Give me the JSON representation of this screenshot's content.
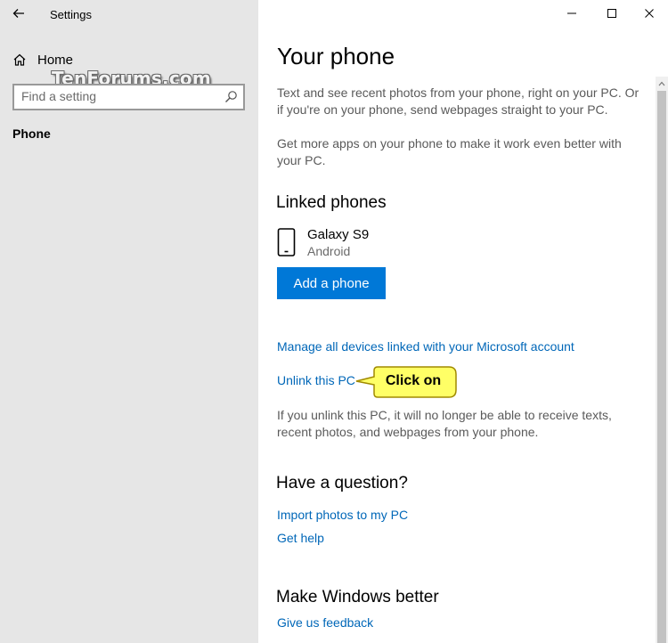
{
  "window": {
    "title": "Settings",
    "controls": {
      "minimize": "minimize",
      "maximize": "maximize",
      "close": "close"
    }
  },
  "sidebar": {
    "home_label": "Home",
    "watermark": "TenForums.com",
    "search_placeholder": "Find a setting",
    "nav_items": [
      {
        "label": "Phone",
        "selected": true
      }
    ]
  },
  "main": {
    "title": "Your phone",
    "description_1": "Text and see recent photos from your phone, right on your PC. Or if you're on your phone, send webpages straight to your PC.",
    "description_2": "Get more apps on your phone to make it work even better with your PC.",
    "linked_phones": {
      "heading": "Linked phones",
      "device": {
        "name": "Galaxy S9",
        "os": "Android"
      },
      "add_button": "Add a phone"
    },
    "links": {
      "manage": "Manage all devices linked with your Microsoft account",
      "unlink": "Unlink this PC"
    },
    "unlink_note": "If you unlink this PC, it will no longer be able to receive texts, recent photos, and webpages from your phone.",
    "question": {
      "heading": "Have a question?",
      "links": [
        "Import photos to my PC",
        "Get help"
      ]
    },
    "better": {
      "heading": "Make Windows better",
      "link": "Give us feedback"
    }
  },
  "callout": {
    "text": "Click on",
    "fill": "#ffff66",
    "border": "#a08a00"
  },
  "colors": {
    "accent": "#0078d7",
    "link": "#0067b8",
    "sidebar_bg": "#e6e6e6"
  }
}
